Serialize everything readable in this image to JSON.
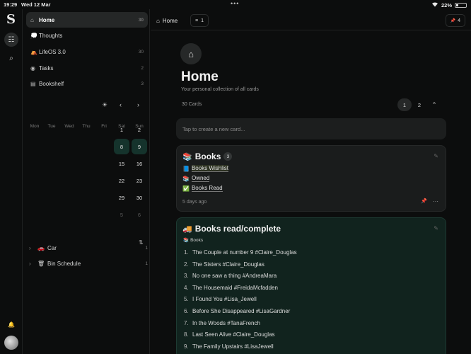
{
  "status_bar": {
    "time": "19:29",
    "date": "Wed 12 Mar",
    "dots": "•••",
    "battery": "22%"
  },
  "rail": {
    "logo": "S",
    "items": [
      {
        "icon": "cards-icon",
        "glyph": "☷"
      },
      {
        "icon": "search-icon",
        "glyph": "⌕"
      }
    ],
    "bell_glyph": "🔔"
  },
  "sidebar": {
    "items": [
      {
        "label": "Home",
        "count": "30",
        "glyph": "⌂",
        "icon": "home-icon"
      },
      {
        "label": "Thoughts",
        "count": "",
        "glyph": "💭",
        "icon": "thought-bubble-icon"
      },
      {
        "label": "LifeOS 3.0",
        "count": "30",
        "glyph": "⛺",
        "icon": "lifeos-icon"
      },
      {
        "label": "Tasks",
        "count": "2",
        "glyph": "◉",
        "icon": "tasks-icon"
      },
      {
        "label": "Bookshelf",
        "count": "3",
        "glyph": "▤",
        "icon": "bookshelf-icon"
      }
    ],
    "calendar": {
      "sun_glyph": "☀",
      "prev_glyph": "‹",
      "next_glyph": "›",
      "weekdays": [
        "Mon",
        "Tue",
        "Wed",
        "Thu",
        "Fri",
        "Sat",
        "Sun"
      ],
      "days": [
        {
          "n": "1"
        },
        {
          "n": "2"
        },
        {
          "n": "8",
          "hl": true
        },
        {
          "n": "9",
          "hl": true
        },
        {
          "n": "15"
        },
        {
          "n": "16"
        },
        {
          "n": "22"
        },
        {
          "n": "23"
        },
        {
          "n": "29"
        },
        {
          "n": "30"
        },
        {
          "n": "5",
          "dim": true
        },
        {
          "n": "6",
          "dim": true
        }
      ]
    },
    "sort_glyph": "⇅",
    "tree": [
      {
        "label": "Car",
        "emoji": "🚗",
        "count": "1"
      },
      {
        "label": "Bin Schedule",
        "emoji": "🗑",
        "count": "1"
      }
    ]
  },
  "topbar": {
    "crumb": "Home",
    "crumb_glyph": "⌂",
    "filter_glyph": "≡",
    "filter_count": "1",
    "pin_glyph": "📌",
    "pin_count": "4"
  },
  "page": {
    "home_glyph": "⌂",
    "title": "Home",
    "subtitle": "Your personal collection of all cards",
    "cards_count": "30 Cards",
    "pages": [
      "1",
      "2"
    ],
    "collapse_glyph": "⌃",
    "new_card_placeholder": "Tap to create a new card..."
  },
  "card_books": {
    "title_glyph": "📚",
    "title": "Books",
    "badge": "3",
    "edit_glyph": "✎",
    "links": [
      {
        "emoji": "📘",
        "text": "Books Wishlist"
      },
      {
        "emoji": "📚",
        "text": "Owned"
      },
      {
        "emoji": "✅",
        "text": "Books Read"
      }
    ],
    "meta": "5 days ago",
    "pin_glyph": "📌",
    "more_glyph": "···"
  },
  "card_read": {
    "title_glyph": "🚚",
    "title": "Books read/complete",
    "edit_glyph": "✎",
    "tag_glyph": "📚",
    "tag": "Books",
    "items": [
      "The Couple at number 9 #Claire_Douglas",
      "The Sisters #Claire_Douglas",
      "No one saw a thing #AndreaMara",
      "The Housemaid #FreidaMcfadden",
      "I Found You #Lisa_Jewell",
      "Before She Disappeared #LisaGardner",
      "In the Woods #TanaFrench",
      "Last Seen Alive #Claire_Douglas",
      "The Family Upstairs #LisaJewell"
    ]
  }
}
